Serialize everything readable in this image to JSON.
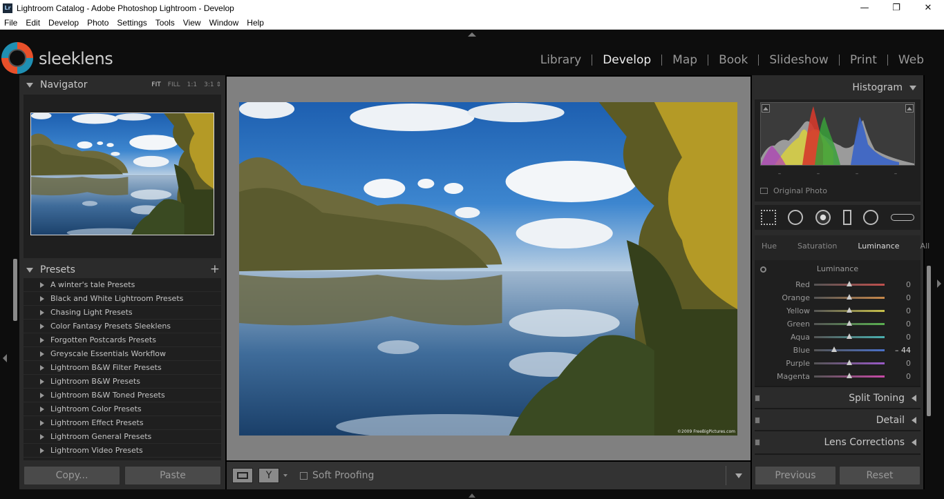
{
  "window": {
    "title": "Lightroom Catalog - Adobe Photoshop Lightroom - Develop",
    "app_icon": "Lr",
    "minimize": "—",
    "maximize": "❐",
    "close": "✕"
  },
  "menu": [
    "File",
    "Edit",
    "Develop",
    "Photo",
    "Settings",
    "Tools",
    "View",
    "Window",
    "Help"
  ],
  "brand": "sleeklens",
  "modules": [
    {
      "label": "Library",
      "active": false
    },
    {
      "label": "Develop",
      "active": true
    },
    {
      "label": "Map",
      "active": false
    },
    {
      "label": "Book",
      "active": false
    },
    {
      "label": "Slideshow",
      "active": false
    },
    {
      "label": "Print",
      "active": false
    },
    {
      "label": "Web",
      "active": false
    }
  ],
  "navigator": {
    "title": "Navigator",
    "zoom": [
      "FIT",
      "FILL",
      "1:1",
      "3:1 ⇕"
    ],
    "active_zoom": "FIT"
  },
  "presets": {
    "title": "Presets",
    "add": "+",
    "items": [
      "A winter's tale Presets",
      "Black and White Lightroom Presets",
      "Chasing Light Presets",
      "Color Fantasy Presets Sleeklens",
      "Forgotten Postcards Presets",
      "Greyscale Essentials Workflow",
      "Lightroom B&W Filter Presets",
      "Lightroom B&W Presets",
      "Lightroom B&W Toned Presets",
      "Lightroom Color Presets",
      "Lightroom Effect Presets",
      "Lightroom General Presets",
      "Lightroom Video Presets"
    ]
  },
  "left_buttons": {
    "copy": "Copy...",
    "paste": "Paste"
  },
  "photo": {
    "copyright": "©2009 FreeBigPictures.com"
  },
  "toolbar": {
    "soft_proofing": "Soft Proofing"
  },
  "histogram": {
    "title": "Histogram",
    "dashes": [
      "–",
      "–",
      "–",
      "–"
    ],
    "original_photo": "Original Photo"
  },
  "hsl": {
    "tabs": [
      "Hue",
      "Saturation",
      "Luminance",
      "All"
    ],
    "active_tab": "Luminance",
    "section": "Luminance",
    "sliders": [
      {
        "name": "Red",
        "value": "0",
        "level": 0,
        "color": "#c0504d"
      },
      {
        "name": "Orange",
        "value": "0",
        "level": 0,
        "color": "#c8884a"
      },
      {
        "name": "Yellow",
        "value": "0",
        "level": 0,
        "color": "#c8c04a"
      },
      {
        "name": "Green",
        "value": "0",
        "level": 0,
        "color": "#5ab050"
      },
      {
        "name": "Aqua",
        "value": "0",
        "level": 0,
        "color": "#4ab0b0"
      },
      {
        "name": "Blue",
        "value": "– 44",
        "level": -44,
        "color": "#4a70c8"
      },
      {
        "name": "Purple",
        "value": "0",
        "level": 0,
        "color": "#9a5ac8"
      },
      {
        "name": "Magenta",
        "value": "0",
        "level": 0,
        "color": "#c84aa8"
      }
    ]
  },
  "right_sections": {
    "split_toning": "Split Toning",
    "detail": "Detail",
    "lens_corrections": "Lens Corrections"
  },
  "right_buttons": {
    "previous": "Previous",
    "reset": "Reset"
  }
}
